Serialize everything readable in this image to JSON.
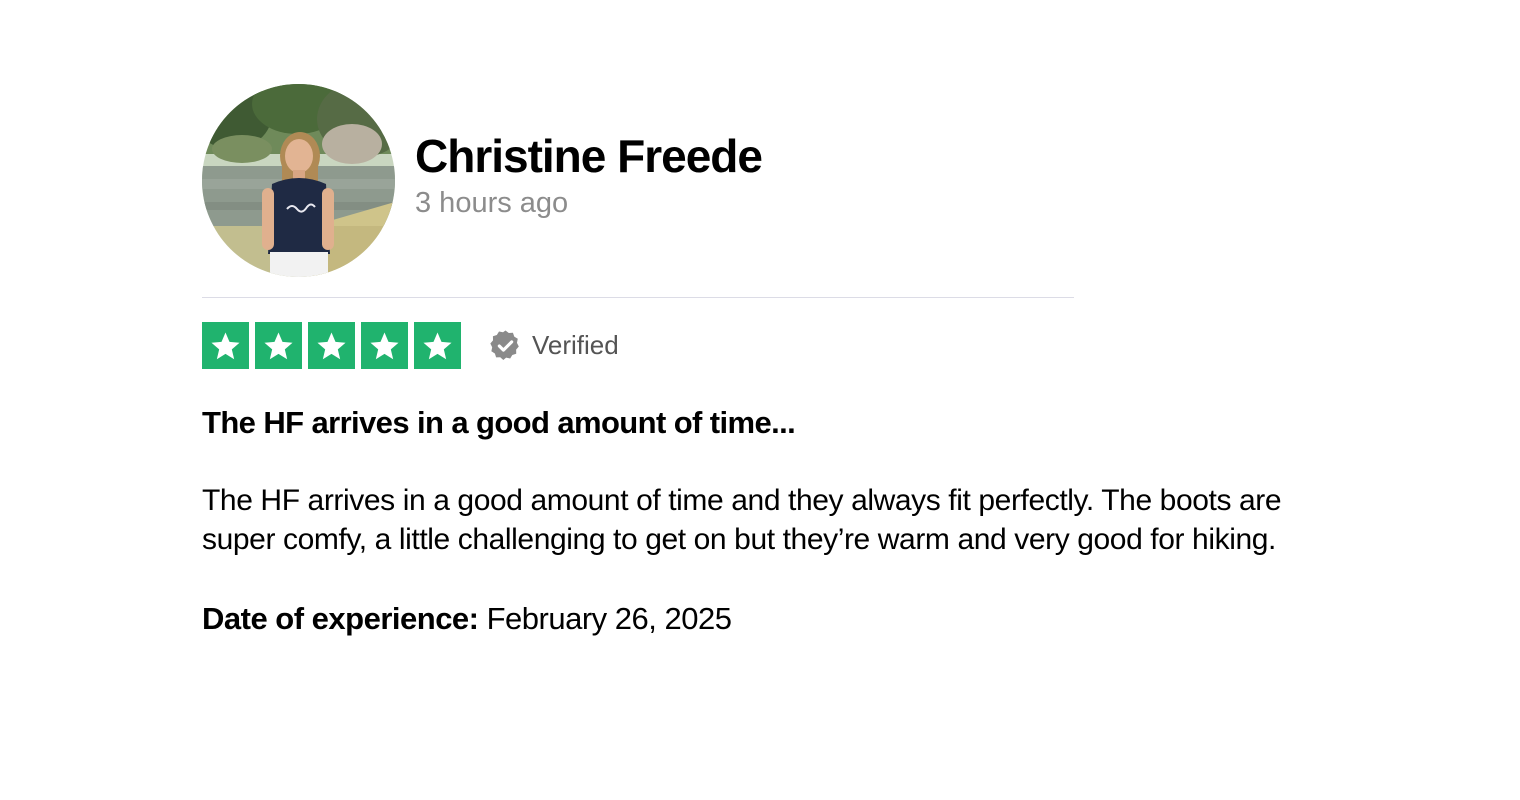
{
  "review": {
    "consumer_name": "Christine Freede",
    "time_ago": "3 hours ago",
    "rating": 5,
    "rating_max": 5,
    "verified_label": "Verified",
    "title": "The HF arrives in a good amount of time...",
    "body": "The HF arrives in a good amount of time and they always fit perfectly. The boots are super comfy, a little challenging to get on but they’re warm and very good for hiking.",
    "date_label": "Date of experience:",
    "date_value": "February 26, 2025"
  },
  "icons": {
    "avatar": "avatar-photo",
    "star": "star-icon",
    "verified": "verified-check-icon"
  },
  "colors": {
    "star_green": "#20b36e",
    "muted_text": "#8c8c8c",
    "verified_gray": "#8a8a8a"
  }
}
